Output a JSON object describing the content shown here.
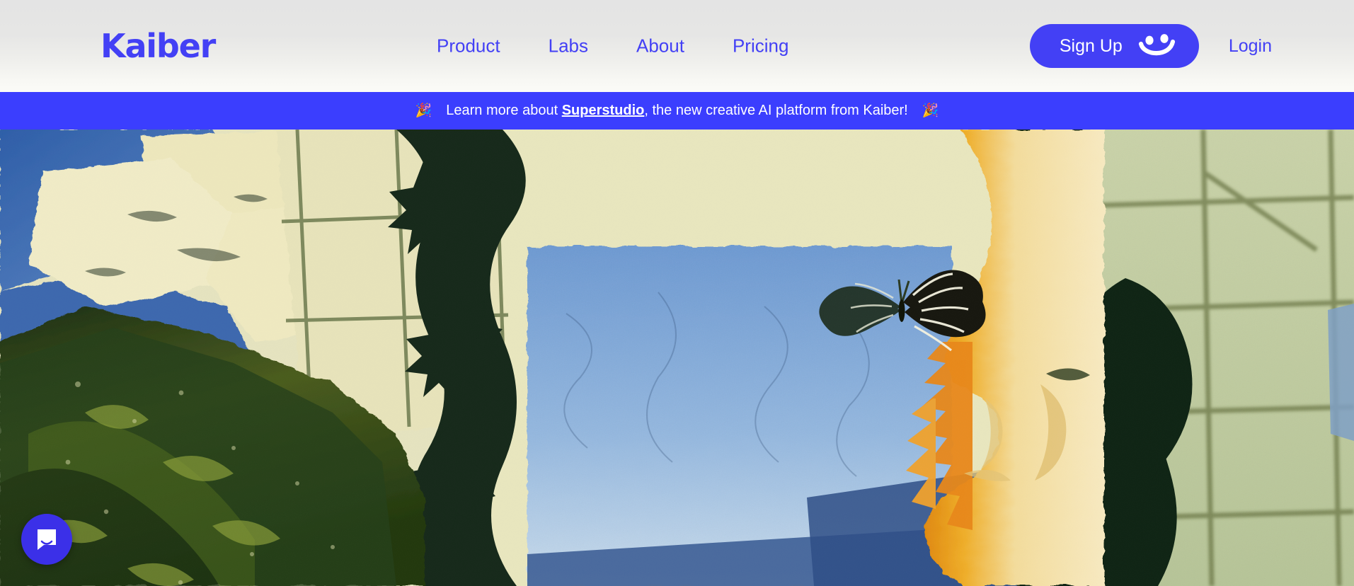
{
  "brand": {
    "logo_text": "Kaiber",
    "accent_blue": "#4340F5",
    "banner_blue": "#3B3EFE",
    "header_bg_top": "#E4E4E4",
    "header_bg_bottom": "#FBFBF7",
    "white": "#FFFFFF"
  },
  "header": {
    "nav": [
      {
        "label": "Product",
        "name": "nav-link-product"
      },
      {
        "label": "Labs",
        "name": "nav-link-labs"
      },
      {
        "label": "About",
        "name": "nav-link-about"
      },
      {
        "label": "Pricing",
        "name": "nav-link-pricing"
      }
    ],
    "signup_label": "Sign Up",
    "signup_icon": "smiley-face-icon",
    "login_label": "Login"
  },
  "banner": {
    "emoji_left": "🎉",
    "emoji_right": "🎉",
    "text_before": "Learn more about ",
    "link_text": "Superstudio",
    "text_after": ", the new creative AI platform from Kaiber!"
  },
  "hero": {
    "alt": "Surreal collage artwork: human face profile in cream and orange tones with butterfly, dark foliage, blue sky panel and sage-green grid background",
    "palette": {
      "sky_blue": "#6E9BD4",
      "pale_blue": "#AFC9E4",
      "cream": "#EDE8C4",
      "sage": "#C6CFA6",
      "deep_green": "#17301B",
      "orange": "#E8881A",
      "skin": "#F3DFA8",
      "deep_blue": "#3F63A8"
    }
  },
  "intercom": {
    "label": "Open Intercom Messenger",
    "icon": "chat-bubble-icon",
    "color": "#3B30E8"
  }
}
